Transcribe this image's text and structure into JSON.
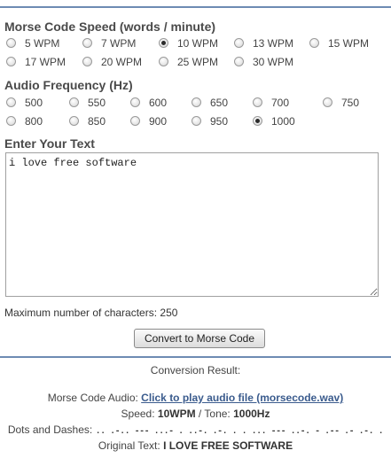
{
  "speed": {
    "title": "Morse Code Speed (words / minute)",
    "rows": [
      [
        {
          "label": "5 WPM",
          "checked": false
        },
        {
          "label": "7 WPM",
          "checked": false
        },
        {
          "label": "10 WPM",
          "checked": true
        },
        {
          "label": "13 WPM",
          "checked": false
        },
        {
          "label": "15 WPM",
          "checked": false
        }
      ],
      [
        {
          "label": "17 WPM",
          "checked": false
        },
        {
          "label": "20 WPM",
          "checked": false
        },
        {
          "label": "25 WPM",
          "checked": false
        },
        {
          "label": "30 WPM",
          "checked": false
        }
      ]
    ]
  },
  "frequency": {
    "title": "Audio Frequency (Hz)",
    "rows": [
      [
        {
          "label": "500",
          "checked": false
        },
        {
          "label": "550",
          "checked": false
        },
        {
          "label": "600",
          "checked": false
        },
        {
          "label": "650",
          "checked": false
        },
        {
          "label": "700",
          "checked": false
        },
        {
          "label": "750",
          "checked": false
        }
      ],
      [
        {
          "label": "800",
          "checked": false
        },
        {
          "label": "850",
          "checked": false
        },
        {
          "label": "900",
          "checked": false
        },
        {
          "label": "950",
          "checked": false
        },
        {
          "label": "1000",
          "checked": true
        }
      ]
    ]
  },
  "text_input": {
    "title": "Enter Your Text",
    "value": "i love free software",
    "max_chars_label": "Maximum number of characters: 250"
  },
  "convert_button": "Convert to Morse Code",
  "result": {
    "heading": "Conversion Result:",
    "audio_label": "Morse Code Audio:",
    "audio_link": "Click to play audio file (morsecode.wav)",
    "speed_label": "Speed:",
    "speed_value": "10WPM",
    "separator": " / ",
    "tone_label": "Tone:",
    "tone_value": "1000Hz",
    "dots_label": "Dots and Dashes:",
    "dots_value": ".. .-.. --- ...- . ..-. .-. . . ... --- ..-. - .-- .- .-. .",
    "original_label": "Original Text:",
    "original_value": "I LOVE FREE SOFTWARE"
  }
}
